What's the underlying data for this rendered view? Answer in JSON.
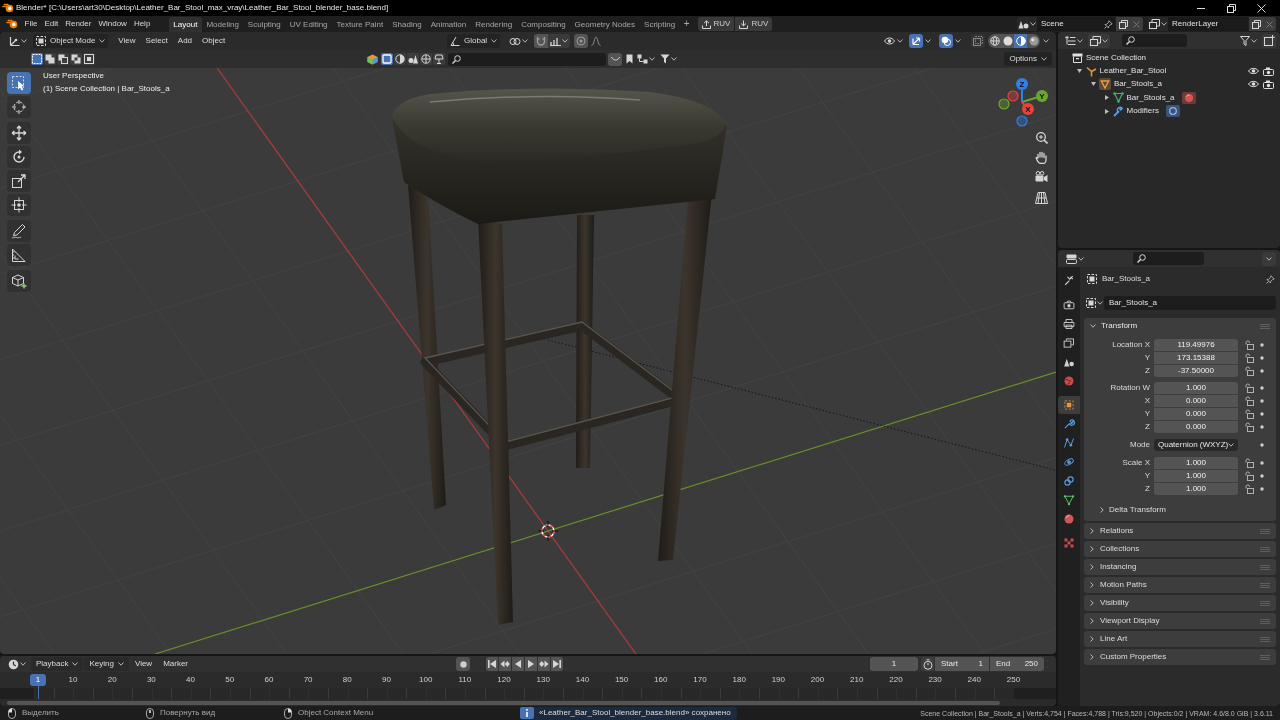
{
  "window": {
    "title": "Blender* [C:\\Users\\art30\\Desktop\\Leather_Bar_Stool_max_vray\\Leather_Bar_Stool_blender_base.blend]"
  },
  "menu": [
    "File",
    "Edit",
    "Render",
    "Window",
    "Help"
  ],
  "workspaces": [
    {
      "label": "Layout",
      "selected": true
    },
    {
      "label": "Modeling",
      "selected": false
    },
    {
      "label": "Sculpting",
      "selected": false
    },
    {
      "label": "UV Editing",
      "selected": false
    },
    {
      "label": "Texture Paint",
      "selected": false
    },
    {
      "label": "Shading",
      "selected": false
    },
    {
      "label": "Animation",
      "selected": false
    },
    {
      "label": "Rendering",
      "selected": false
    },
    {
      "label": "Compositing",
      "selected": false
    },
    {
      "label": "Geometry Nodes",
      "selected": false
    },
    {
      "label": "Scripting",
      "selected": false
    }
  ],
  "add_workspace": "+",
  "addon_buttons": [
    {
      "kind": "upload",
      "label": "RUV"
    },
    {
      "kind": "download",
      "label": "RUV"
    }
  ],
  "scene": "Scene",
  "view_layer": "RenderLayer",
  "viewport": {
    "mode": "Object Mode",
    "menus": [
      "View",
      "Select",
      "Add",
      "Object"
    ],
    "orientation": "Global",
    "show_gizmos": true,
    "show_overlays": true,
    "xray": false,
    "shading": [
      {
        "selected": false
      },
      {
        "selected": false
      },
      {
        "selected": true
      },
      {
        "selected": false
      }
    ],
    "select_modes": [
      {
        "selected": true
      },
      {
        "selected": false
      },
      {
        "selected": false
      },
      {
        "selected": false
      },
      {
        "selected": false
      }
    ],
    "filters": [
      {
        "selected": true
      },
      {
        "selected": false
      },
      {
        "selected": false
      },
      {
        "selected": false
      },
      {
        "selected": false
      }
    ],
    "options": "Options",
    "info": [
      "User Perspective",
      "(1) Scene Collection | Bar_Stools_a"
    ],
    "tools": [
      {
        "selected": true
      },
      {
        "selected": false
      },
      {
        "selected": false
      },
      {
        "selected": false
      },
      {
        "selected": false
      },
      {
        "selected": false
      },
      {
        "selected": false
      },
      {
        "selected": false
      },
      {
        "selected": false
      }
    ],
    "gizmo_axes": [
      "Z",
      "Y",
      "X"
    ]
  },
  "timeline": {
    "menus": [
      {
        "label": "Playback",
        "dropdown": true
      },
      {
        "label": "Keying",
        "dropdown": true
      },
      {
        "label": "View",
        "dropdown": false
      },
      {
        "label": "Marker",
        "dropdown": false
      }
    ],
    "auto_keying": false,
    "frame": "1",
    "start": {
      "label": "Start",
      "value": "1"
    },
    "end": {
      "label": "End",
      "value": "250"
    },
    "playhead": "1",
    "ticks": [
      "10",
      "20",
      "30",
      "40",
      "50",
      "60",
      "70",
      "80",
      "90",
      "100",
      "110",
      "120",
      "130",
      "140",
      "150",
      "160",
      "170",
      "180",
      "190",
      "200",
      "210",
      "220",
      "230",
      "240",
      "250"
    ]
  },
  "outliner": {
    "tree": [
      {
        "label": "Scene Collection",
        "kind": "scene_collection",
        "children": [
          {
            "label": "Leather_Bar_Stool",
            "kind": "empty",
            "expanded": true,
            "children": [
              {
                "label": "Bar_Stools_a",
                "kind": "object",
                "expanded": true,
                "children": [
                  {
                    "label": "Bar_Stools_a",
                    "kind": "mesh",
                    "expanded": false
                  },
                  {
                    "label": "Modifiers",
                    "kind": "modifiers",
                    "expanded": false
                  }
                ]
              }
            ]
          }
        ]
      }
    ]
  },
  "properties": {
    "tabs": [
      {
        "selected": false
      },
      {
        "selected": false
      },
      {
        "selected": false
      },
      {
        "selected": false
      },
      {
        "selected": false
      },
      {
        "selected": false
      },
      {
        "selected": true
      },
      {
        "selected": false
      },
      {
        "selected": false
      },
      {
        "selected": false
      },
      {
        "selected": false
      },
      {
        "selected": false
      },
      {
        "selected": false
      },
      {
        "selected": false
      }
    ],
    "context": "Bar_Stools_a",
    "name": "Bar_Stools_a",
    "transform": {
      "title": "Transform",
      "expanded": true,
      "groups": [
        {
          "rows": [
            {
              "kind": "number",
              "label": "Location X",
              "value": "119.49976"
            },
            {
              "kind": "number",
              "label": "Y",
              "value": "173.15388"
            },
            {
              "kind": "number",
              "label": "Z",
              "value": "-37.50000"
            }
          ]
        },
        {
          "rows": [
            {
              "kind": "number",
              "label": "Rotation W",
              "value": "1.000"
            },
            {
              "kind": "number",
              "label": "X",
              "value": "0.000"
            },
            {
              "kind": "number",
              "label": "Y",
              "value": "0.000"
            },
            {
              "kind": "number",
              "label": "Z",
              "value": "0.000"
            }
          ]
        },
        {
          "rows": [
            {
              "kind": "dropdown",
              "label": "Mode",
              "value": "Quaternion (WXYZ)"
            }
          ]
        },
        {
          "rows": [
            {
              "kind": "number",
              "label": "Scale X",
              "value": "1.000"
            },
            {
              "kind": "number",
              "label": "Y",
              "value": "1.000"
            },
            {
              "kind": "number",
              "label": "Z",
              "value": "1.000"
            }
          ]
        }
      ],
      "subpanel": {
        "title": "Delta Transform",
        "expanded": false
      }
    },
    "panels": [
      {
        "title": "Relations",
        "expanded": false
      },
      {
        "title": "Collections",
        "expanded": false
      },
      {
        "title": "Instancing",
        "expanded": false
      },
      {
        "title": "Motion Paths",
        "expanded": false
      },
      {
        "title": "Visibility",
        "expanded": false
      },
      {
        "title": "Viewport Display",
        "expanded": false
      },
      {
        "title": "Line Art",
        "expanded": false
      },
      {
        "title": "Custom Properties",
        "expanded": false
      }
    ]
  },
  "status_bar": {
    "hints": [
      {
        "kind": "lmb",
        "label": "Выделить"
      },
      {
        "kind": "mmb",
        "label": "Повернуть вид"
      },
      {
        "kind": "rmb",
        "label": "Object Context Menu"
      }
    ],
    "message": "«Leather_Bar_Stool_blender_base.blend» сохранено",
    "stats": "Scene Collection | Bar_Stools_a | Verts:4,754 | Faces:4,788 | Tris:9,520 | Objects:0/2 | VRAM: 4.6/8.0 GiB | 3.6.11"
  }
}
